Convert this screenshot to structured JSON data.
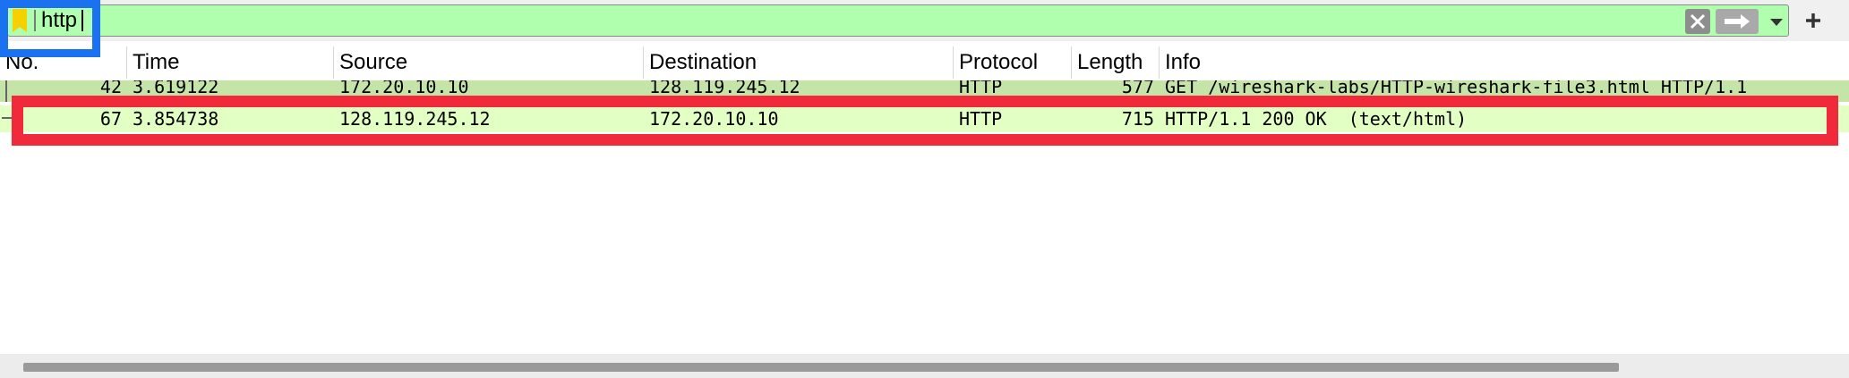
{
  "filter": {
    "value": "http",
    "icons": {
      "bookmark": "bookmark-icon",
      "clear": "clear-icon",
      "apply": "arrow-right-icon",
      "dropdown": "chevron-down-icon",
      "add": "plus-icon"
    }
  },
  "columns": [
    "No.",
    "Time",
    "Source",
    "Destination",
    "Protocol",
    "Length",
    "Info"
  ],
  "rows": [
    {
      "no": "42",
      "time": "3.619122",
      "source": "172.20.10.10",
      "destination": "128.119.245.12",
      "protocol": "HTTP",
      "length": "577",
      "info": "GET /wireshark-labs/HTTP-wireshark-file3.html HTTP/1.1"
    },
    {
      "no": "67",
      "time": "3.854738",
      "source": "128.119.245.12",
      "destination": "172.20.10.10",
      "protocol": "HTTP",
      "length": "715",
      "info": "HTTP/1.1 200 OK  (text/html)"
    }
  ],
  "colors": {
    "filter_valid_bg": "#afffaf",
    "request_row_bg": "#c4e4a8",
    "response_row_bg": "#e2ffc4",
    "highlight_blue": "#1b72f0",
    "highlight_red": "#f02a3a"
  }
}
